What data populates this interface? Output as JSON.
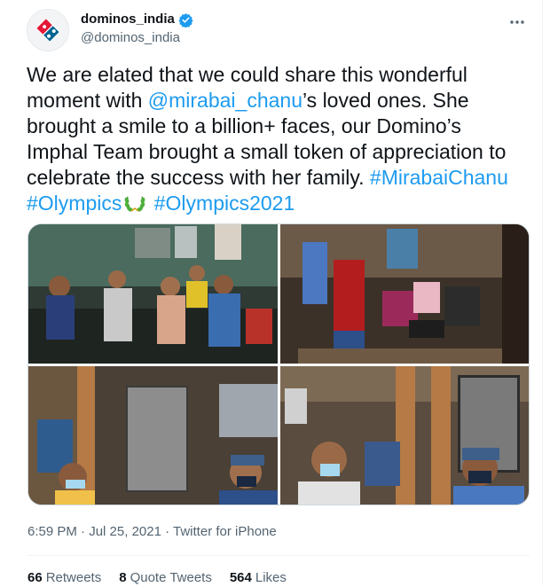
{
  "account": {
    "display_name": "dominos_india",
    "handle": "@dominos_india",
    "verified": true,
    "brand_colors": [
      "#006491",
      "#e31837"
    ]
  },
  "more_icon": "more-horizontal-icon",
  "tweet": {
    "text_before_mention": "We are elated that we could share this wonderful moment with ",
    "mention": "@mirabai_chanu",
    "text_after_mention": "’s loved ones. She brought a smile to a billion+ faces, our Domino’s Imphal Team brought a small token of appreciation to celebrate the success with her family. ",
    "hashtag_1": "#MirabaiChanu",
    "hashtag_2": "#Olympics",
    "emoji": "laurel-wreath-icon",
    "hashtag_3": "#Olympics2021",
    "link_color": "#1d9bf0"
  },
  "media": {
    "count": 4,
    "descriptions": [
      "family-gathering-photo",
      "team-with-gifts-photo",
      "woman-and-man-portrait-photo",
      "man-and-man-portrait-photo"
    ]
  },
  "meta": {
    "time": "6:59 PM",
    "separator_1": " · ",
    "date": "Jul 25, 2021",
    "separator_2": " · ",
    "source": "Twitter for iPhone"
  },
  "stats": {
    "retweets_count": "66",
    "retweets_label": "Retweets",
    "quotes_count": "8",
    "quotes_label": "Quote Tweets",
    "likes_count": "564",
    "likes_label": "Likes"
  }
}
